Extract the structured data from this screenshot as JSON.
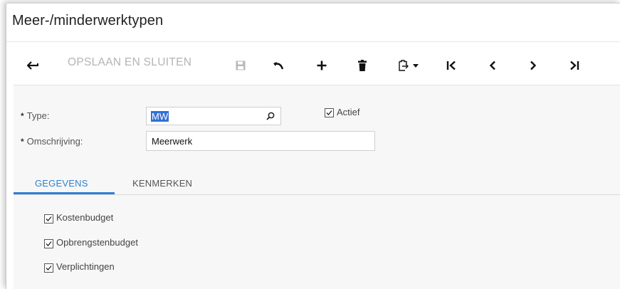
{
  "window": {
    "title": "Meer-/minderwerktypen"
  },
  "toolbar": {
    "save_close_label": "OPSLAAN EN SLUITEN",
    "icons": [
      "back-arrow-icon",
      "save-icon",
      "undo-icon",
      "add-icon",
      "delete-icon",
      "clipboard-icon",
      "first-record-icon",
      "previous-record-icon",
      "next-record-icon",
      "last-record-icon"
    ]
  },
  "form": {
    "type_label": "Type:",
    "type_value": "MW",
    "description_label": "Omschrijving:",
    "description_value": "Meerwerk",
    "active_label": "Actief",
    "active_checked": true,
    "required_marker": "*"
  },
  "tabs": [
    {
      "label": "GEGEVENS",
      "active": true
    },
    {
      "label": "KENMERKEN",
      "active": false
    }
  ],
  "details": {
    "checkboxes": [
      {
        "label": "Kostenbudget",
        "checked": true
      },
      {
        "label": "Opbrengstenbudget",
        "checked": true
      },
      {
        "label": "Verplichtingen",
        "checked": true
      }
    ]
  },
  "colors": {
    "accent": "#2d7fd3",
    "selection": "#3170d8",
    "disabled_text": "#b4b4b4"
  }
}
